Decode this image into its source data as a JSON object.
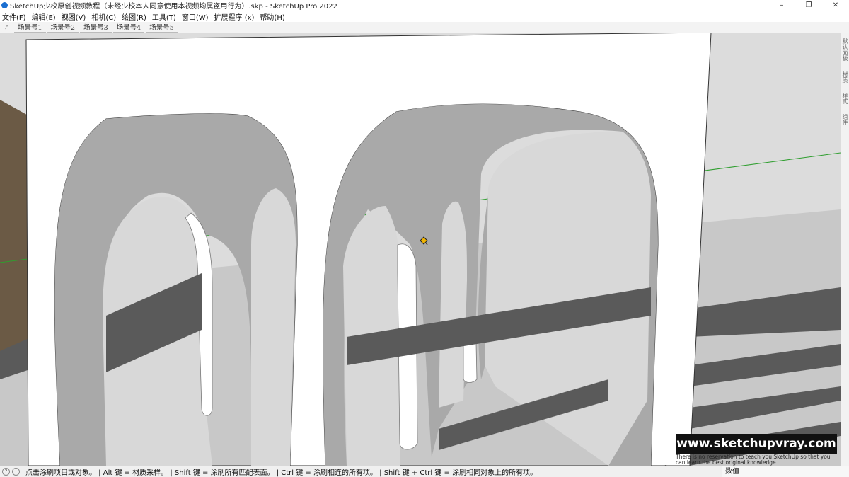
{
  "window": {
    "title": "SketchUp少校原创视频教程（未经少校本人同意使用本视频均属盗用行为）.skp - SketchUp Pro 2022",
    "minimize": "–",
    "maximize": "❐",
    "close": "✕"
  },
  "menu": [
    "文件(F)",
    "编辑(E)",
    "视图(V)",
    "相机(C)",
    "绘图(R)",
    "工具(T)",
    "窗口(W)",
    "扩展程序 (x)",
    "帮助(H)"
  ],
  "scenes": {
    "search_icon": "search-icon",
    "tabs": [
      "场景号1",
      "场景号2",
      "场景号3",
      "场景号4",
      "场景号5"
    ]
  },
  "right_panel": {
    "labels": [
      "默认面板",
      "材质",
      "样式",
      "组件"
    ]
  },
  "status": {
    "hint": "点击涂刷项目或对象。 | Alt 键 = 材质采样。 | Shift 键 = 涂刷所有匹配表面。 | Ctrl 键 = 涂刷相连的所有项。 | Shift 键 + Ctrl 键 = 涂刷相同对象上的所有项。",
    "measurements_label": "数值",
    "measurements_value": ""
  },
  "watermark": {
    "url": "www.sketchupvray.com",
    "tagline": "There is no reservation to teach you SketchUp so that you can learn the best original knowledge."
  },
  "colors": {
    "sky": "#dcdcdc",
    "ground": "#c6c6c6",
    "shadow": "#5e5e5e",
    "wall": "#ffffff",
    "arch_inner": "#a9a9a9",
    "green_axis": "#2f9e2f",
    "wall_brown": "#6b5a45"
  }
}
